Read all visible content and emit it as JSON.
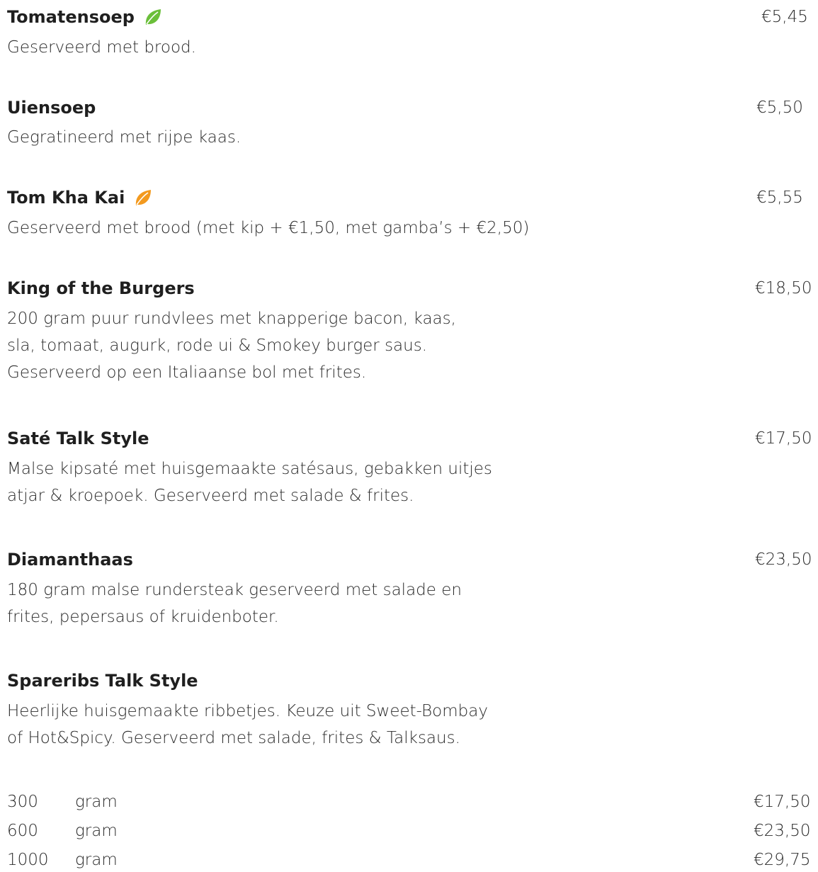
{
  "menu": {
    "items": [
      {
        "name": "Tomatensoep",
        "leaf_icon": "leaf-icon",
        "leaf_color": "#6bbf3a",
        "price": "€5,45",
        "description": [
          "Geserveerd met brood."
        ]
      },
      {
        "name": "Uiensoep",
        "price": "€5,50",
        "description": [
          "Gegratineerd met rijpe kaas."
        ]
      },
      {
        "name": "Tom Kha Kai",
        "leaf_icon": "leaf-icon",
        "leaf_color": "#f39a1f",
        "price": "€5,55",
        "description": [
          "Geserveerd met brood (met kip + €1,50, met gamba’s + €2,50)"
        ]
      },
      {
        "name": "King of the Burgers",
        "price": "€18,50",
        "description": [
          "200 gram puur rundvlees met knapperige bacon, kaas,",
          "sla, tomaat, augurk, rode ui & Smokey burger saus.",
          "Geserveerd op een Italiaanse bol met frites."
        ]
      },
      {
        "name": "Saté Talk Style",
        "price": "€17,50",
        "description": [
          "Malse kipsaté met huisgemaakte satésaus, gebakken uitjes",
          "atjar & kroepoek. Geserveerd met salade & frites."
        ]
      },
      {
        "name": "Diamanthaas",
        "price": "€23,50",
        "description": [
          "180 gram malse rundersteak geserveerd met salade en",
          "frites, pepersaus of kruidenboter."
        ]
      },
      {
        "name": "Spareribs Talk Style",
        "description": [
          "Heerlijke huisgemaakte ribbetjes. Keuze uit Sweet-Bombay",
          "of Hot&Spicy. Geserveerd met salade, frites & Talksaus."
        ],
        "weights": [
          {
            "amount": "300",
            "unit": "gram",
            "price": "€17,50"
          },
          {
            "amount": "600",
            "unit": "gram",
            "price": "€23,50"
          },
          {
            "amount": "1000",
            "unit": "gram",
            "price": "€29,75"
          }
        ]
      }
    ]
  }
}
